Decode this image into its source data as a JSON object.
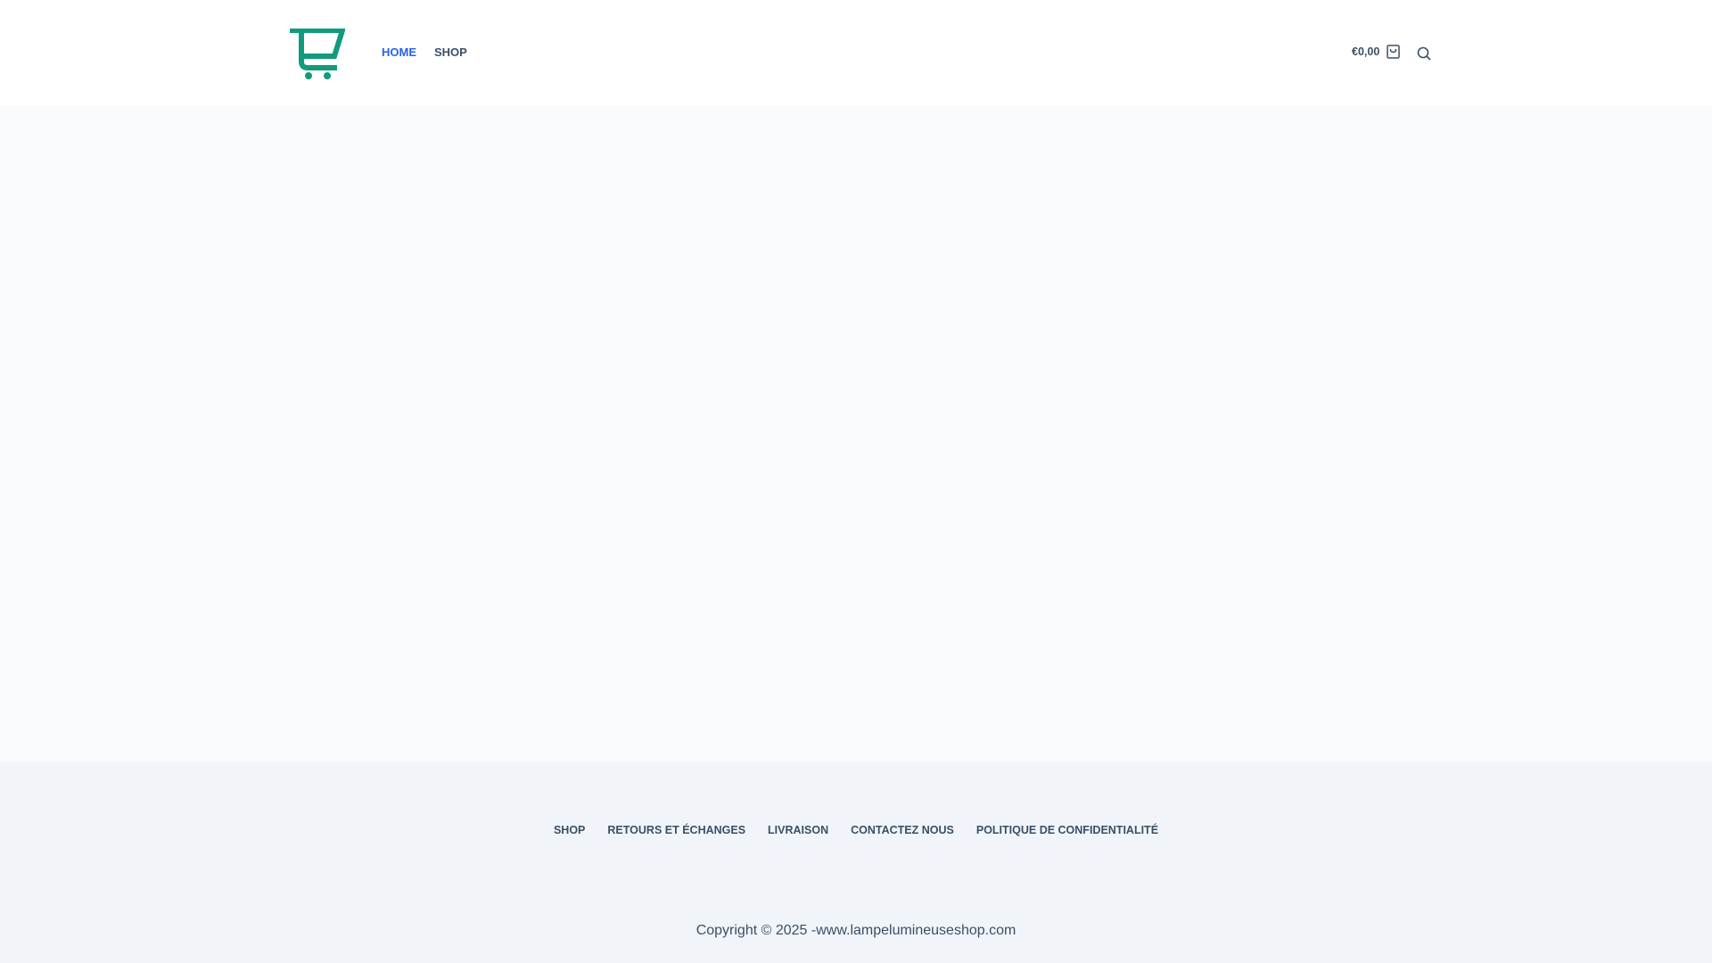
{
  "brand": {
    "accent": "#119b7c",
    "logo_name": "cart-logo"
  },
  "header": {
    "nav": [
      {
        "label": "HOME",
        "active": true
      },
      {
        "label": "SHOP",
        "active": false
      }
    ],
    "cart_total": "€0,00"
  },
  "footer": {
    "links": [
      {
        "label": "SHOP"
      },
      {
        "label": "RETOURS ET ÉCHANGES"
      },
      {
        "label": "LIVRAISON"
      },
      {
        "label": "CONTACTEZ NOUS"
      },
      {
        "label": "POLITIQUE DE CONFIDENTIALITÉ"
      }
    ],
    "copyright": "Copyright © 2025 -www.lampelumineuseshop.com"
  }
}
